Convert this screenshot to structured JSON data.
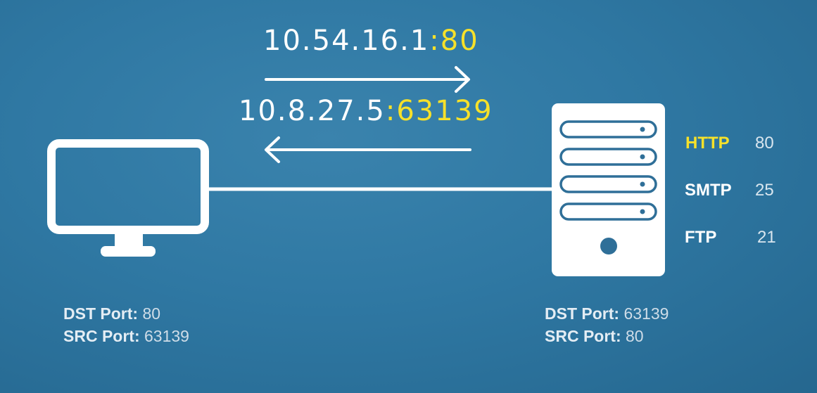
{
  "request": {
    "ip": "10.54.16.1",
    "port": ":80"
  },
  "response": {
    "ip": "10.8.27.5",
    "port": ":63139"
  },
  "services": [
    {
      "name": "HTTP",
      "port": "80",
      "highlighted": true
    },
    {
      "name": "SMTP",
      "port": "25",
      "highlighted": false
    },
    {
      "name": "FTP",
      "port": "21",
      "highlighted": false
    }
  ],
  "client_info": {
    "dst_label": "DST Port:",
    "dst_value": "80",
    "src_label": "SRC Port:",
    "src_value": "63139"
  },
  "server_info": {
    "dst_label": "DST Port:",
    "dst_value": "63139",
    "src_label": "SRC Port:",
    "src_value": "80"
  },
  "colors": {
    "background": "#2f78a3",
    "foreground": "#ffffff",
    "accent": "#f6e12a"
  },
  "icons": {
    "client": "monitor-icon",
    "server": "server-tower-icon"
  }
}
